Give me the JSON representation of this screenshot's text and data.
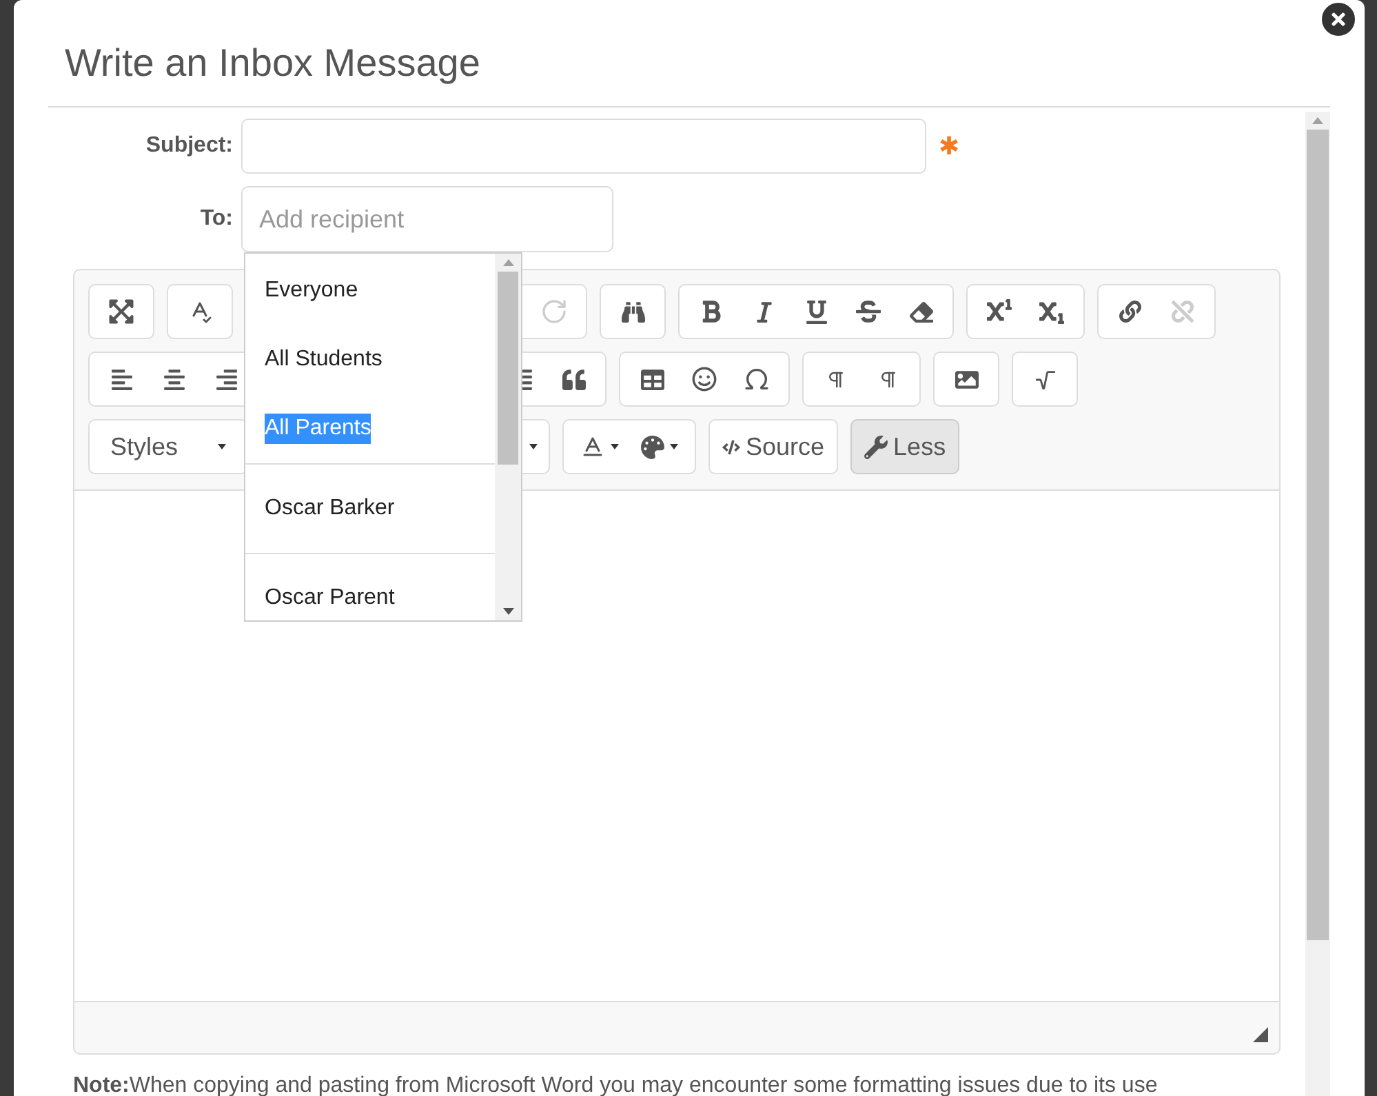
{
  "dialog": {
    "title": "Write an Inbox Message"
  },
  "subject": {
    "label": "Subject:",
    "required": true,
    "required_mark": "✱"
  },
  "to": {
    "label": "To:",
    "placeholder": "Add recipient"
  },
  "recipients": [
    {
      "label": "Everyone",
      "selected": false
    },
    {
      "label": "All Students",
      "selected": false
    },
    {
      "label": "All Parents",
      "selected": true
    },
    {
      "label": "Oscar Barker",
      "selected": false,
      "divider_before": true
    },
    {
      "label": "Oscar Parent",
      "selected": false,
      "divider_before": true
    }
  ],
  "toolbar": {
    "styles": "Styles",
    "source": "Source",
    "less": {
      "label": "Less",
      "pressed": true
    },
    "redo": {
      "disabled": true
    },
    "unlink": {
      "disabled": true
    }
  },
  "note": "**Note:**When copying and pasting from Microsoft Word you may encounter some formatting issues due to its use"
}
